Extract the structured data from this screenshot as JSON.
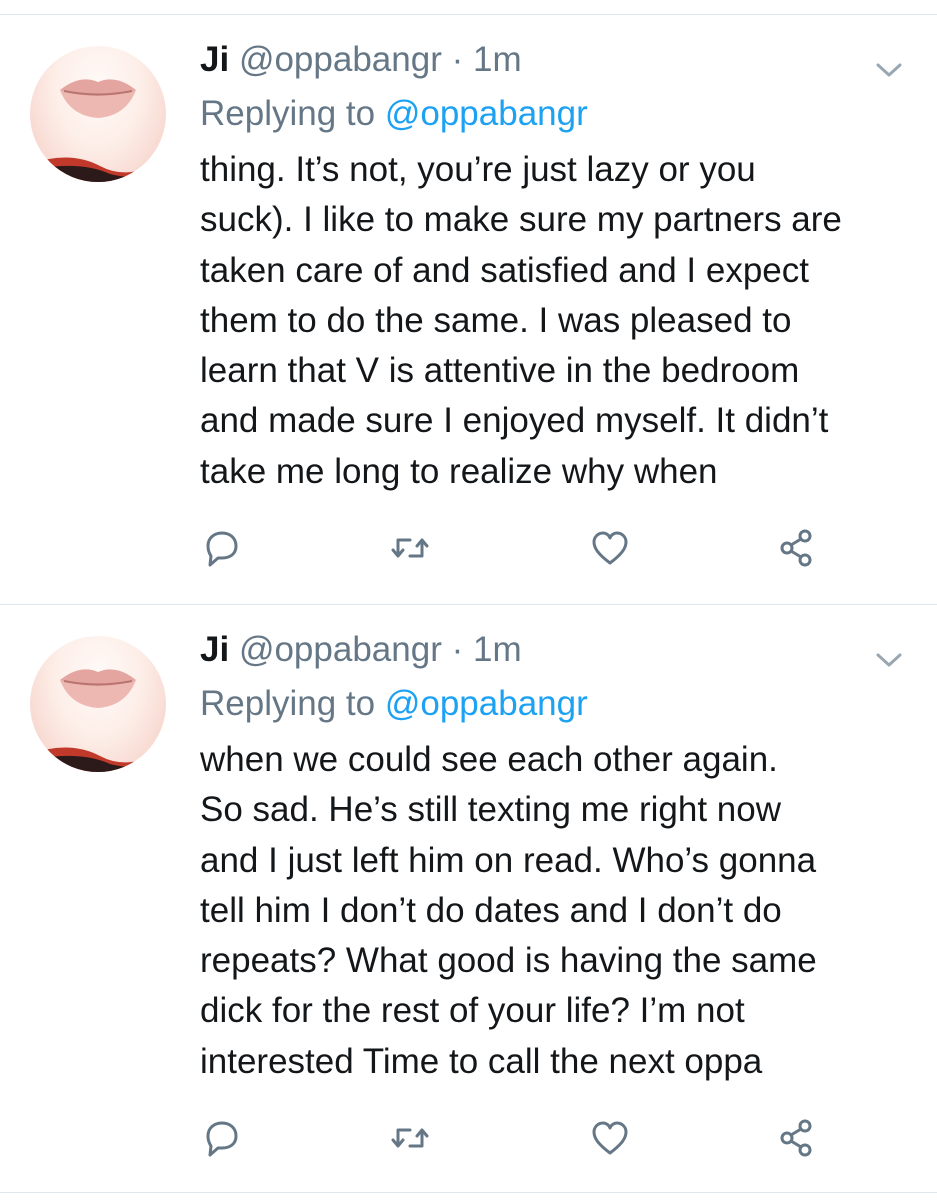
{
  "tweets": [
    {
      "name": "Ji",
      "handle": "@oppabangr",
      "dot": "·",
      "time": "1m",
      "replying_prefix": "Replying to",
      "replying_handle": "@oppabangr",
      "lines": [
        "thing. It’s not, you’re just lazy or you",
        "suck). I like to make sure my partners are",
        "taken care of and satisfied and I expect",
        "them to do the same. I was pleased to",
        "learn that V is attentive in the bedroom",
        "and made sure I enjoyed myself. It didn’t",
        "take me long to realize why when"
      ],
      "icons": {
        "reply": "reply-icon",
        "retweet": "retweet-icon",
        "like": "heart-icon",
        "share": "share-icon",
        "menu": "chevron-down-icon"
      }
    },
    {
      "name": "Ji",
      "handle": "@oppabangr",
      "dot": "·",
      "time": "1m",
      "replying_prefix": "Replying to",
      "replying_handle": "@oppabangr",
      "lines": [
        "when we could see each other again.",
        "So sad. He’s still texting me right now",
        "and I just left him on read. Who’s gonna",
        "tell him I don’t do dates and I don’t do",
        "repeats? What good is having the same",
        "dick for the rest of your life? I’m not",
        "interested Time to call the next oppa"
      ],
      "icons": {
        "reply": "reply-icon",
        "retweet": "retweet-icon",
        "like": "heart-icon",
        "share": "share-icon",
        "menu": "chevron-down-icon"
      }
    }
  ],
  "colors": {
    "text": "#14171a",
    "secondary": "#657786",
    "link": "#1da1f2",
    "divider": "#e1e8ed",
    "icon": "#657786"
  }
}
